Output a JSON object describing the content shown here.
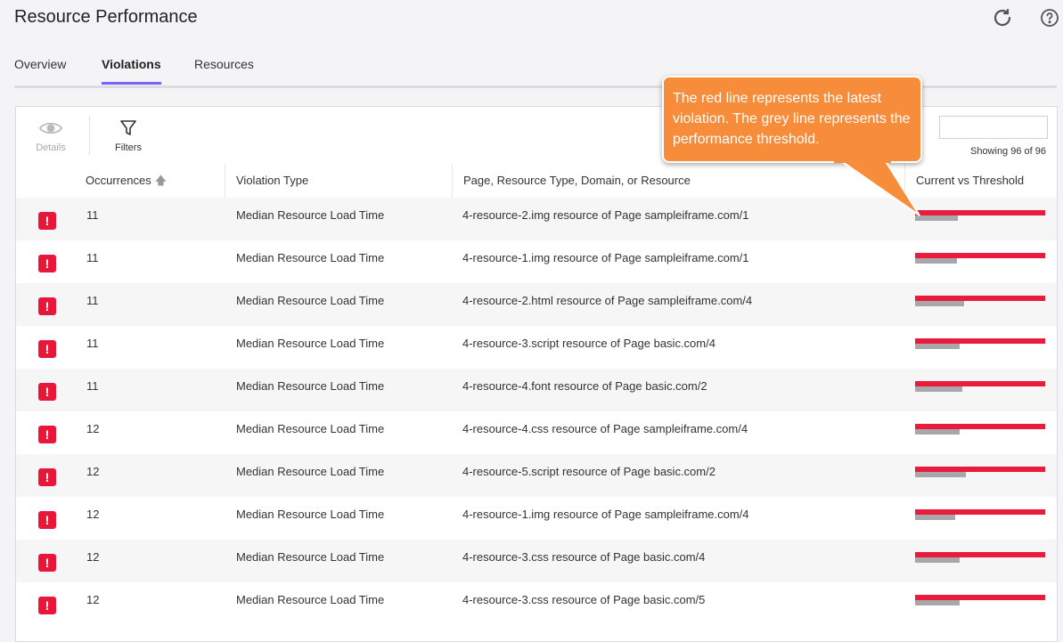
{
  "page": {
    "title": "Resource Performance"
  },
  "tabs": [
    {
      "label": "Overview"
    },
    {
      "label": "Violations"
    },
    {
      "label": "Resources"
    }
  ],
  "toolbar": {
    "details_label": "Details",
    "filters_label": "Filters"
  },
  "showing": "Showing 96 of 96",
  "table": {
    "headers": [
      "Occurrences",
      "Violation Type",
      "Page, Resource Type, Domain, or Resource",
      "Current vs Threshold"
    ],
    "rows": [
      {
        "occurrences": "11",
        "type": "Median Resource Load Time",
        "resource": "4-resource-2.img resource of Page sampleiframe.com/1",
        "threshold_ratio": 0.33
      },
      {
        "occurrences": "11",
        "type": "Median Resource Load Time",
        "resource": "4-resource-1.img resource of Page sampleiframe.com/1",
        "threshold_ratio": 0.32
      },
      {
        "occurrences": "11",
        "type": "Median Resource Load Time",
        "resource": "4-resource-2.html resource of Page sampleiframe.com/4",
        "threshold_ratio": 0.38
      },
      {
        "occurrences": "11",
        "type": "Median Resource Load Time",
        "resource": "4-resource-3.script resource of Page basic.com/4",
        "threshold_ratio": 0.34
      },
      {
        "occurrences": "11",
        "type": "Median Resource Load Time",
        "resource": "4-resource-4.font resource of Page basic.com/2",
        "threshold_ratio": 0.36
      },
      {
        "occurrences": "12",
        "type": "Median Resource Load Time",
        "resource": "4-resource-4.css resource of Page sampleiframe.com/4",
        "threshold_ratio": 0.34
      },
      {
        "occurrences": "12",
        "type": "Median Resource Load Time",
        "resource": "4-resource-5.script resource of Page basic.com/2",
        "threshold_ratio": 0.39
      },
      {
        "occurrences": "12",
        "type": "Median Resource Load Time",
        "resource": "4-resource-1.img resource of Page sampleiframe.com/4",
        "threshold_ratio": 0.31
      },
      {
        "occurrences": "12",
        "type": "Median Resource Load Time",
        "resource": "4-resource-3.css resource of Page basic.com/4",
        "threshold_ratio": 0.34
      },
      {
        "occurrences": "12",
        "type": "Median Resource Load Time",
        "resource": "4-resource-3.css resource of Page basic.com/5",
        "threshold_ratio": 0.34
      }
    ]
  },
  "callout": {
    "text": "The red line represents the latest violation. The grey line represents the performance threshold."
  },
  "colors": {
    "accent": "#7b61ff",
    "violation_red": "#ea1c3d",
    "threshold_grey": "#a8a8ac",
    "callout": "#f78c3a"
  }
}
